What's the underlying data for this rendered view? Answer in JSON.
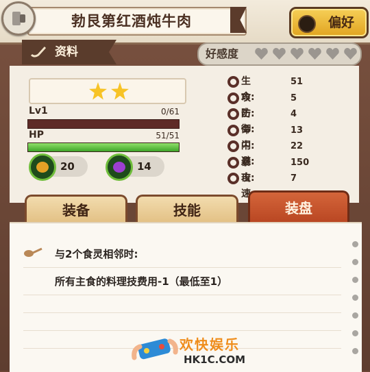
{
  "header": {
    "dish_name": "勃艮第红酒炖牛肉",
    "preference_label": "偏好",
    "section_label": "资料",
    "affinity_label": "好感度",
    "affinity_level": 0,
    "affinity_max": 6
  },
  "card": {
    "stars": 2,
    "level_label": "Lv1",
    "level_value": "0/61",
    "level_fraction": 0,
    "hp_label": "HP",
    "hp_value": "51/51",
    "hp_fraction": 1,
    "resource_1": "20",
    "resource_2": "14"
  },
  "stats": [
    {
      "label": "生命:",
      "value": "51"
    },
    {
      "label": "攻击:",
      "value": "5"
    },
    {
      "label": "防御:",
      "value": "4"
    },
    {
      "label": "命中:",
      "value": "13"
    },
    {
      "label": "闪避:",
      "value": "22"
    },
    {
      "label": "暴击:",
      "value": "150"
    },
    {
      "label": "攻速:",
      "value": "7"
    }
  ],
  "tabs": [
    {
      "label": "装备"
    },
    {
      "label": "技能"
    },
    {
      "label": "装盘"
    }
  ],
  "note": {
    "line1": "与2个食灵相邻时:",
    "line2": "所有主食的料理技费用-1（最低至1）"
  },
  "watermark": {
    "title": "欢快娱乐",
    "url": "HK1C.COM"
  },
  "colors": {
    "accent": "#e1a421",
    "active_tab": "#b5421f",
    "hp_bar": "#3ea52a",
    "frame": "#6b4636"
  }
}
